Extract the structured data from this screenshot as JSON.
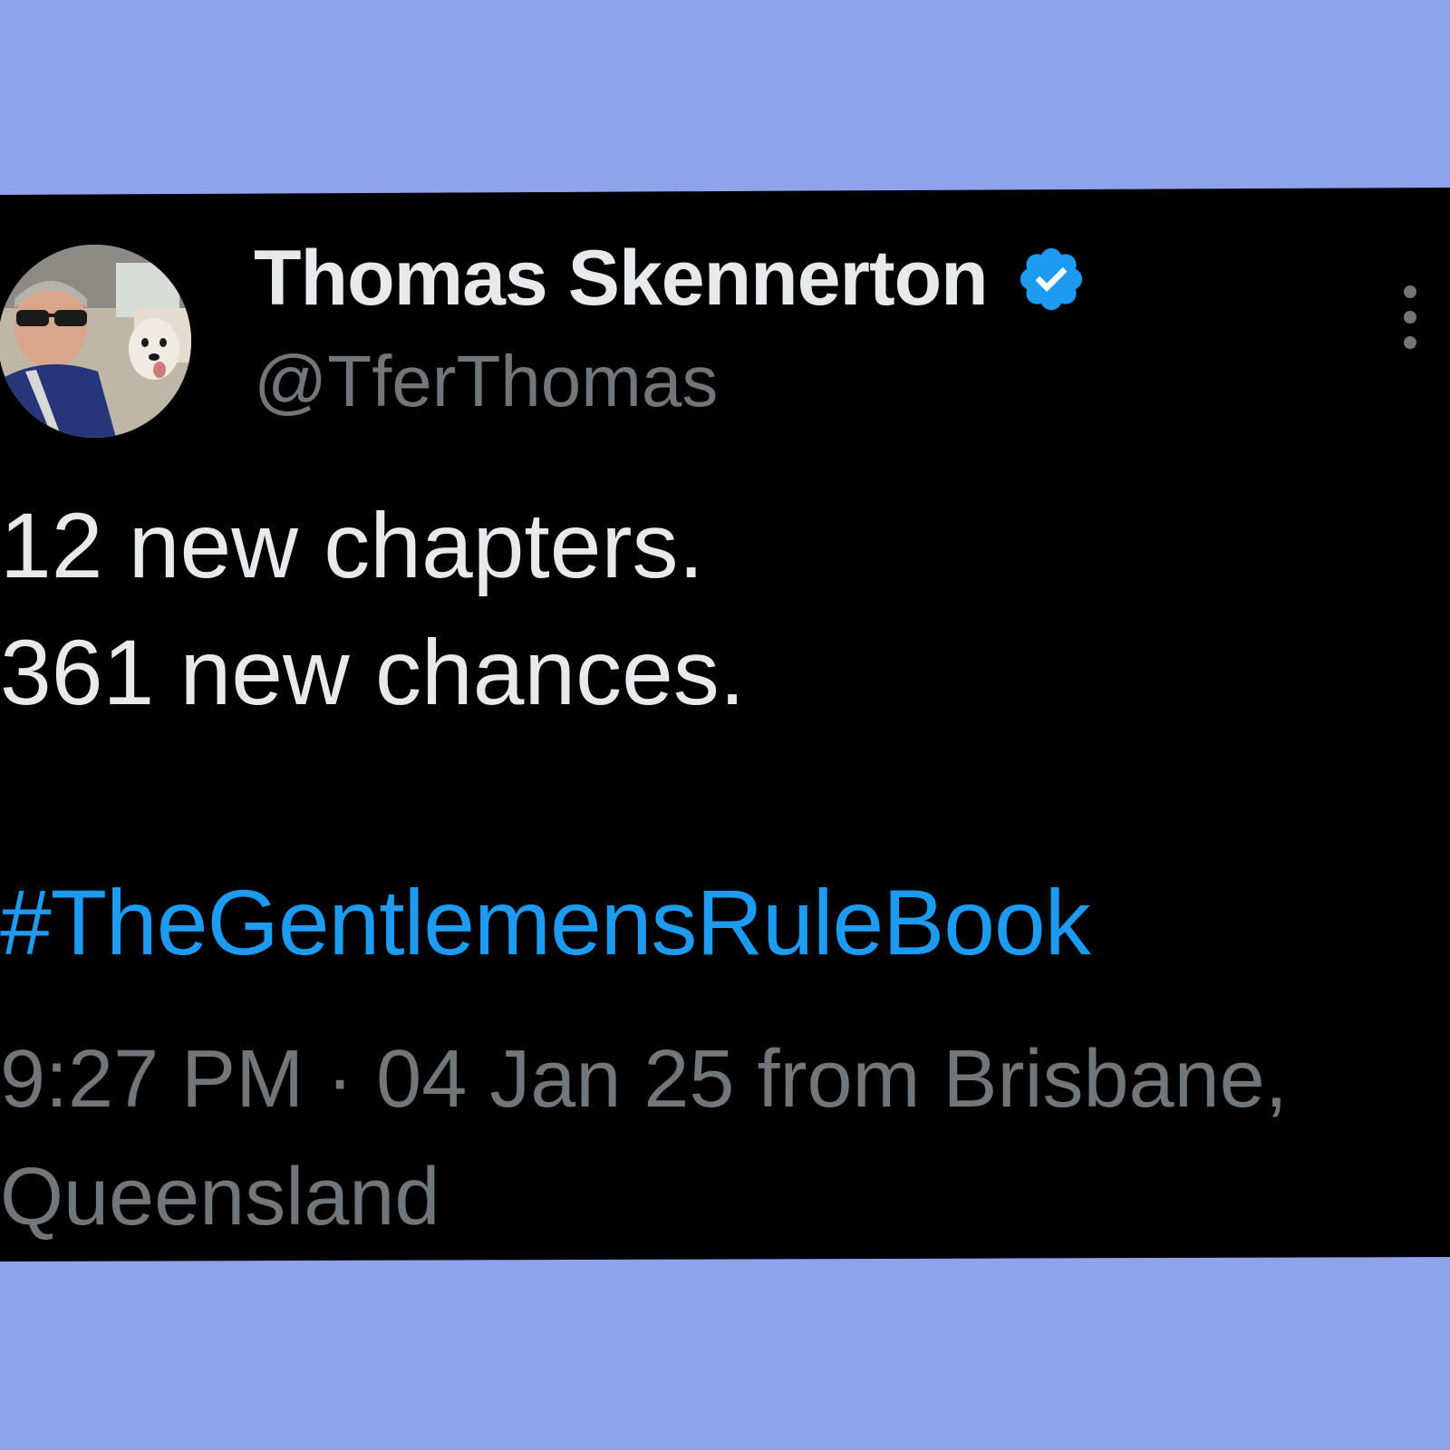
{
  "colors": {
    "background": "#8fa2ec",
    "card": "#000000",
    "primary_text": "#e7e9ea",
    "secondary_text": "#71767b",
    "link": "#1d9bf0",
    "verified_badge": "#1d9bf0"
  },
  "author": {
    "display_name": "Thomas Skennerton",
    "handle": "@TferThomas",
    "verified": true,
    "avatar_icon": "profile-photo-man-with-sunglasses-and-dog"
  },
  "tweet": {
    "lines": [
      "12 new chapters.",
      "361 new chances."
    ],
    "hashtag": "#TheGentlemensRuleBook"
  },
  "meta": {
    "line1": "9:27 PM · 04 Jan 25 from Brisbane,",
    "line2": "Queensland"
  },
  "icons": {
    "verified": "verified-badge-icon",
    "more": "more-vertical-icon"
  }
}
